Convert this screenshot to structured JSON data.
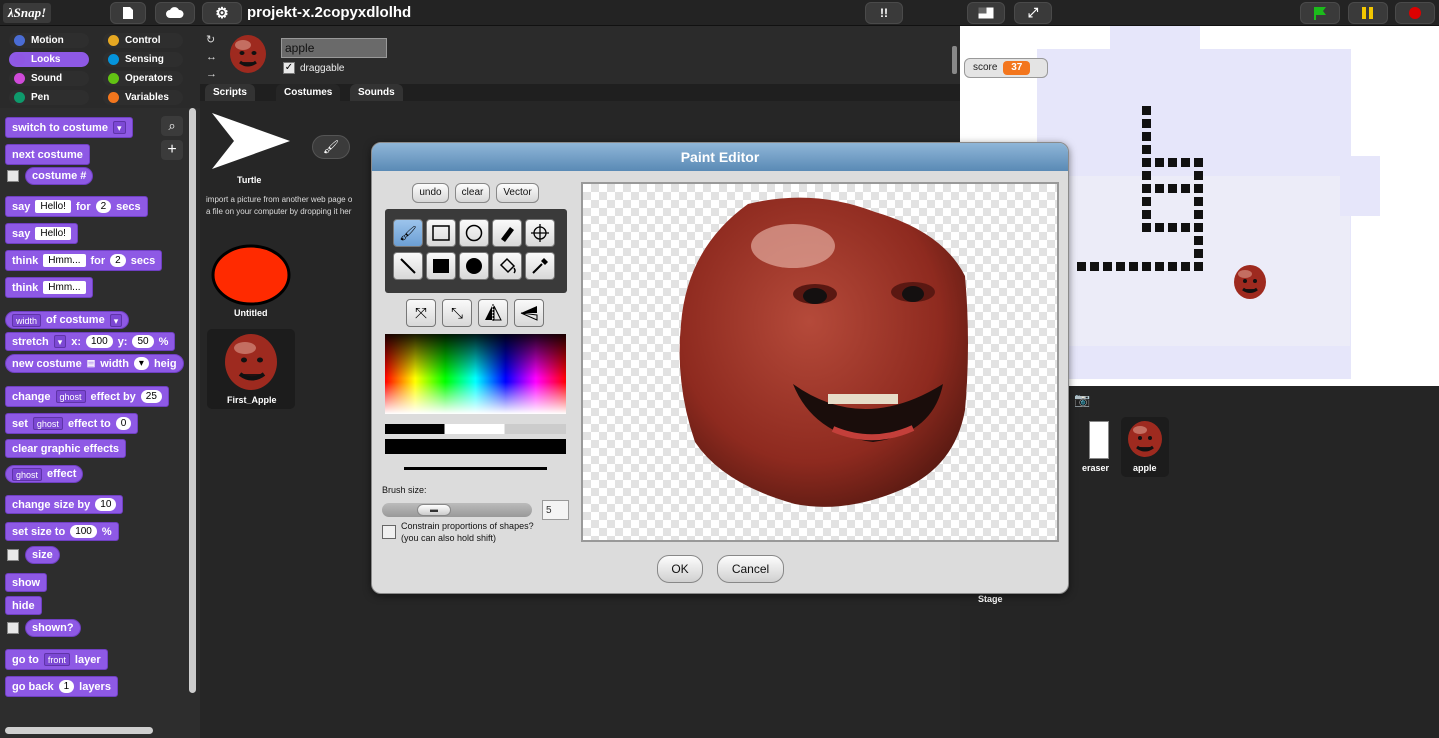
{
  "app": {
    "logo": "λSnap!",
    "project_title": "projekt-x.2copyxdlolhd"
  },
  "categories": [
    {
      "label": "Motion",
      "color": "#4a6cd4"
    },
    {
      "label": "Looks",
      "color": "#8f56e3"
    },
    {
      "label": "Sound",
      "color": "#cf4ad9"
    },
    {
      "label": "Pen",
      "color": "#0e9a6c"
    },
    {
      "label": "Control",
      "color": "#e6a822"
    },
    {
      "label": "Sensing",
      "color": "#0494dc"
    },
    {
      "label": "Operators",
      "color": "#62c213"
    },
    {
      "label": "Variables",
      "color": "#f3761d"
    }
  ],
  "palette": {
    "switch_to_costume": "switch to costume",
    "next_costume": "next costume",
    "costume_num": "costume #",
    "say": "say",
    "for": "for",
    "secs": "secs",
    "hello": "Hello!",
    "two": "2",
    "think": "think",
    "hmm": "Hmm...",
    "width": "width",
    "of_costume": "of costume",
    "stretch": "stretch",
    "x": "x:",
    "y": "y:",
    "hundred": "100",
    "fifty": "50",
    "pct": "%",
    "new_costume": "new costume",
    "width_kw": "width",
    "height_kw": "heig",
    "change": "change",
    "ghost": "ghost",
    "effect_by": "effect by",
    "twenty_five": "25",
    "set": "set",
    "effect_to": "effect to",
    "zero": "0",
    "clear_graphic_effects": "clear graphic effects",
    "effect": "effect",
    "change_size_by": "change size by",
    "ten": "10",
    "set_size_to": "set size to",
    "size": "size",
    "show": "show",
    "hide": "hide",
    "shown": "shown?",
    "go_to": "go to",
    "front": "front",
    "layer": "layer",
    "go_back": "go back",
    "one": "1",
    "layers": "layers"
  },
  "sprite": {
    "name": "apple",
    "draggable_label": "draggable"
  },
  "tabs": [
    "Scripts",
    "Costumes",
    "Sounds"
  ],
  "costumes_pane": {
    "turtle_label": "Turtle",
    "import_hint_1": "import a picture from another web page o",
    "import_hint_2": "a file on your computer by dropping it her",
    "costumes": [
      "Untitled",
      "First_Apple"
    ]
  },
  "stage": {
    "watcher_label": "score",
    "watcher_value": "37"
  },
  "corral": {
    "sprites": [
      "eraser",
      "apple"
    ],
    "stage_label": "Stage"
  },
  "paint_editor": {
    "title": "Paint Editor",
    "undo": "undo",
    "clear": "clear",
    "vector": "Vector",
    "brush_size_label": "Brush size:",
    "brush_size_value": "5",
    "brush_size_fraction": 0.3,
    "constrain_label": "Constrain proportions of shapes?",
    "constrain_hint": "(you can also hold shift)",
    "ok": "OK",
    "cancel": "Cancel"
  },
  "colors": {
    "looks": "#8e59e5",
    "watcher": "#f3761d",
    "dialog_title": "#6f9ac2"
  }
}
